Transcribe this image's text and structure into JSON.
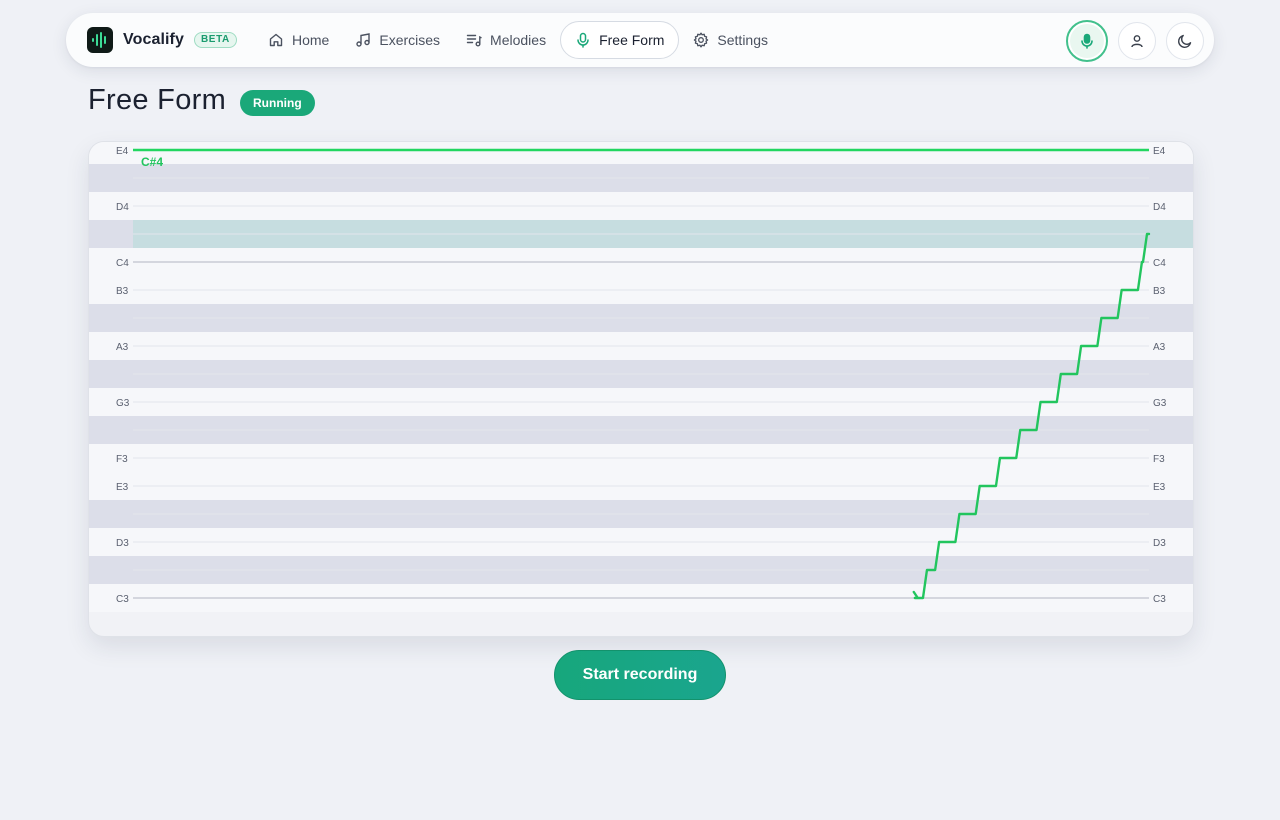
{
  "brand": {
    "name": "Vocalify",
    "badge": "BETA"
  },
  "nav": {
    "items": [
      {
        "label": "Home",
        "icon": "home-icon",
        "active": false
      },
      {
        "label": "Exercises",
        "icon": "music-note-icon",
        "active": false
      },
      {
        "label": "Melodies",
        "icon": "playlist-icon",
        "active": false
      },
      {
        "label": "Free Form",
        "icon": "microphone-icon",
        "active": true
      },
      {
        "label": "Settings",
        "icon": "gear-icon",
        "active": false
      }
    ],
    "actions": [
      {
        "icon": "microphone-icon",
        "active": true
      },
      {
        "icon": "user-icon",
        "active": false
      },
      {
        "icon": "moon-icon",
        "active": false
      }
    ]
  },
  "page": {
    "title": "Free Form",
    "status": "Running"
  },
  "chart_data": {
    "type": "line",
    "y_notes": [
      "C3",
      "C#3",
      "D3",
      "D#3",
      "E3",
      "F3",
      "F#3",
      "G3",
      "G#3",
      "A3",
      "A#3",
      "B3",
      "C4",
      "C#4",
      "D4",
      "D#4",
      "E4"
    ],
    "labeled_notes": [
      "E4",
      "D4",
      "C4",
      "B3",
      "A3",
      "G3",
      "F3",
      "E3",
      "D3",
      "C3"
    ],
    "highlighted_note": "C#4",
    "target_note": "E4",
    "current_note_label": "C#4",
    "series": [
      {
        "x": [
          0.77,
          0.775,
          0.783,
          0.795,
          0.815,
          0.835,
          0.855,
          0.875,
          0.895,
          0.915,
          0.935,
          0.955,
          0.975,
          0.995,
          1.0
        ],
        "values": [
          "C3",
          "C3",
          "C#3",
          "D3",
          "D#3",
          "E3",
          "F3",
          "F#3",
          "G3",
          "G#3",
          "A3",
          "A#3",
          "B3",
          "C4",
          "C#4"
        ]
      }
    ],
    "colors": {
      "pitch": "#22c55e",
      "target": "#22d660",
      "highlight": "#c6dde0",
      "sharp_row": "#dcdee9",
      "natural_row": "#f6f7fa"
    }
  },
  "cta": {
    "label": "Start recording"
  }
}
